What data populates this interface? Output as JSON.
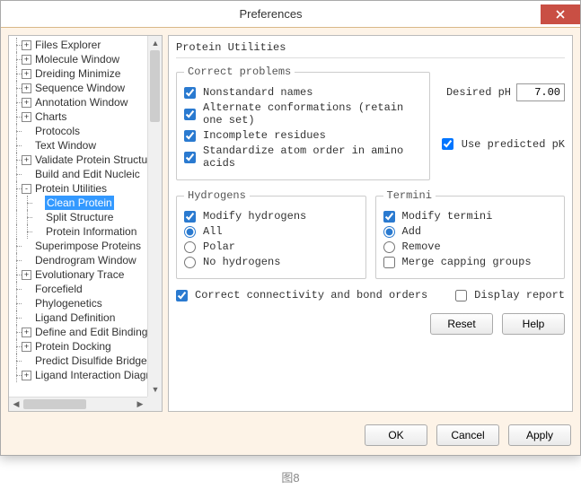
{
  "window": {
    "title": "Preferences",
    "close_icon": "close"
  },
  "tree": [
    {
      "depth": 0,
      "toggle": "+",
      "label": "Files Explorer"
    },
    {
      "depth": 0,
      "toggle": "+",
      "label": "Molecule Window"
    },
    {
      "depth": 0,
      "toggle": "+",
      "label": "Dreiding Minimize"
    },
    {
      "depth": 0,
      "toggle": "+",
      "label": "Sequence Window"
    },
    {
      "depth": 0,
      "toggle": "+",
      "label": "Annotation Window"
    },
    {
      "depth": 0,
      "toggle": "+",
      "label": "Charts"
    },
    {
      "depth": 0,
      "toggle": "",
      "label": "Protocols"
    },
    {
      "depth": 0,
      "toggle": "",
      "label": "Text Window"
    },
    {
      "depth": 0,
      "toggle": "+",
      "label": "Validate Protein Structure"
    },
    {
      "depth": 0,
      "toggle": "",
      "label": "Build and Edit Nucleic"
    },
    {
      "depth": 0,
      "toggle": "-",
      "label": "Protein Utilities"
    },
    {
      "depth": 1,
      "toggle": "",
      "label": "Clean Protein",
      "selected": true
    },
    {
      "depth": 1,
      "toggle": "",
      "label": "Split Structure"
    },
    {
      "depth": 1,
      "toggle": "",
      "label": "Protein Information"
    },
    {
      "depth": 0,
      "toggle": "",
      "label": "Superimpose Proteins"
    },
    {
      "depth": 0,
      "toggle": "",
      "label": "Dendrogram Window"
    },
    {
      "depth": 0,
      "toggle": "+",
      "label": "Evolutionary Trace"
    },
    {
      "depth": 0,
      "toggle": "",
      "label": "Forcefield"
    },
    {
      "depth": 0,
      "toggle": "",
      "label": "Phylogenetics"
    },
    {
      "depth": 0,
      "toggle": "",
      "label": "Ligand Definition"
    },
    {
      "depth": 0,
      "toggle": "+",
      "label": "Define and Edit Binding"
    },
    {
      "depth": 0,
      "toggle": "+",
      "label": "Protein Docking"
    },
    {
      "depth": 0,
      "toggle": "",
      "label": "Predict Disulfide Bridges"
    },
    {
      "depth": 0,
      "toggle": "+",
      "label": "Ligand Interaction Diagram"
    }
  ],
  "panel": {
    "title": "Protein Utilities",
    "correct": {
      "legend": "Correct problems",
      "nonstandard": {
        "label": "Nonstandard names",
        "checked": true
      },
      "alternate": {
        "label": "Alternate conformations (retain one set)",
        "checked": true
      },
      "incomplete": {
        "label": "Incomplete residues",
        "checked": true
      },
      "standardize": {
        "label": "Standardize atom order in amino acids",
        "checked": true
      }
    },
    "ph": {
      "label": "Desired pH",
      "value": "7.00"
    },
    "pk": {
      "label": "Use predicted pK",
      "checked": true
    },
    "hydrogens": {
      "legend": "Hydrogens",
      "modify": {
        "label": "Modify hydrogens",
        "checked": true
      },
      "options": [
        {
          "label": "All",
          "selected": true
        },
        {
          "label": "Polar",
          "selected": false
        },
        {
          "label": "No hydrogens",
          "selected": false
        }
      ]
    },
    "termini": {
      "legend": "Termini",
      "modify": {
        "label": "Modify termini",
        "checked": true
      },
      "options": [
        {
          "label": "Add",
          "selected": true
        },
        {
          "label": "Remove",
          "selected": false
        }
      ],
      "merge": {
        "label": "Merge capping groups",
        "checked": false
      }
    },
    "connectivity": {
      "label": "Correct connectivity and bond orders",
      "checked": true
    },
    "display_report": {
      "label": "Display report",
      "checked": false
    },
    "buttons": {
      "reset": "Reset",
      "help": "Help"
    }
  },
  "footer": {
    "ok": "OK",
    "cancel": "Cancel",
    "apply": "Apply"
  },
  "caption": "图8"
}
